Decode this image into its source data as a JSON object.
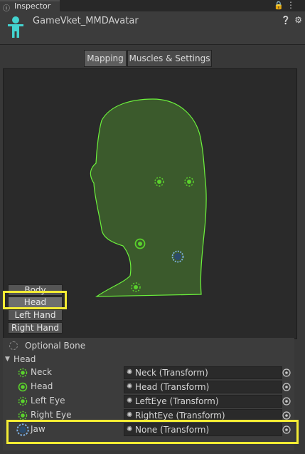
{
  "window": {
    "tab_label": "Inspector",
    "tab_icon": "info-icon",
    "lock_icon": "lock-icon",
    "menu_icon": "kebab-menu-icon"
  },
  "header": {
    "object_name": "GameVket_MMDAvatar",
    "avatar_icon": "humanoid-avatar-icon",
    "help_icon": "help-icon",
    "settings_icon": "gear-icon"
  },
  "tabs": [
    {
      "label": "Mapping",
      "active": true
    },
    {
      "label": "Muscles & Settings",
      "active": false
    }
  ],
  "body_parts": [
    {
      "label": "Body",
      "selected": false
    },
    {
      "label": "Head",
      "selected": true
    },
    {
      "label": "Left Hand",
      "selected": false
    },
    {
      "label": "Right Hand",
      "selected": false
    }
  ],
  "legend": {
    "optional_bone_label": "Optional Bone"
  },
  "section": {
    "title": "Head",
    "expanded": true
  },
  "bones": [
    {
      "name": "Neck",
      "value": "Neck (Transform)",
      "required": false,
      "assigned": true
    },
    {
      "name": "Head",
      "value": "Head (Transform)",
      "required": true,
      "assigned": true
    },
    {
      "name": "Left Eye",
      "value": "LeftEye (Transform)",
      "required": false,
      "assigned": true
    },
    {
      "name": "Right Eye",
      "value": "RightEye (Transform)",
      "required": false,
      "assigned": true
    },
    {
      "name": "Jaw",
      "value": "None (Transform)",
      "required": false,
      "assigned": false
    }
  ],
  "colors": {
    "assigned_green": "#5ad12c",
    "head_fill": "#3a5a2a",
    "head_outline": "#6cf23c",
    "unassigned_blue": "#7fb2e6",
    "highlight_yellow": "#f4ec34"
  }
}
